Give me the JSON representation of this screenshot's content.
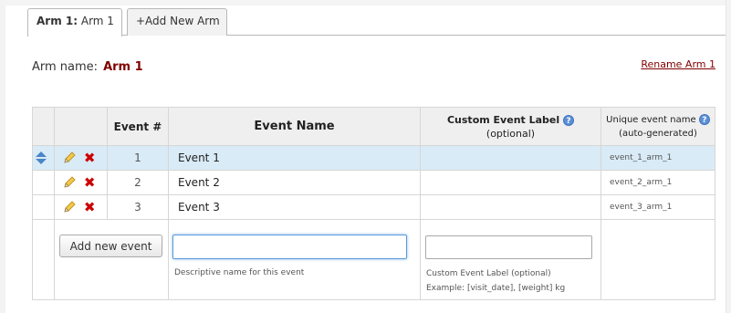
{
  "tabs": {
    "active_prefix": "Arm 1:",
    "active_name": "Arm 1",
    "add_label": "+Add New Arm"
  },
  "arm": {
    "name_label": "Arm name:",
    "name_value": "Arm 1",
    "rename_link": "Rename Arm 1"
  },
  "table": {
    "headers": {
      "event_num": "Event #",
      "event_name": "Event Name",
      "custom_label": "Custom Event Label",
      "custom_label_sub": "(optional)",
      "unique_name": "Unique event name",
      "unique_name_sub": "(auto-generated)"
    },
    "rows": [
      {
        "num": "1",
        "name": "Event 1",
        "custom": "",
        "unique": "event_1_arm_1"
      },
      {
        "num": "2",
        "name": "Event 2",
        "custom": "",
        "unique": "event_2_arm_1"
      },
      {
        "num": "3",
        "name": "Event 3",
        "custom": "",
        "unique": "event_3_arm_1"
      }
    ]
  },
  "add_form": {
    "button_label": "Add new event",
    "name_value": "",
    "name_hint": "Descriptive name for this event",
    "custom_value": "",
    "custom_hint": "Custom Event Label (optional)",
    "custom_example": "Example: [visit_date], [weight] kg"
  },
  "colors": {
    "accent_dark_red": "#800000",
    "selected_row": "#d9ebf6",
    "delete_red": "#cc0000",
    "help_blue": "#5b8fd6"
  }
}
